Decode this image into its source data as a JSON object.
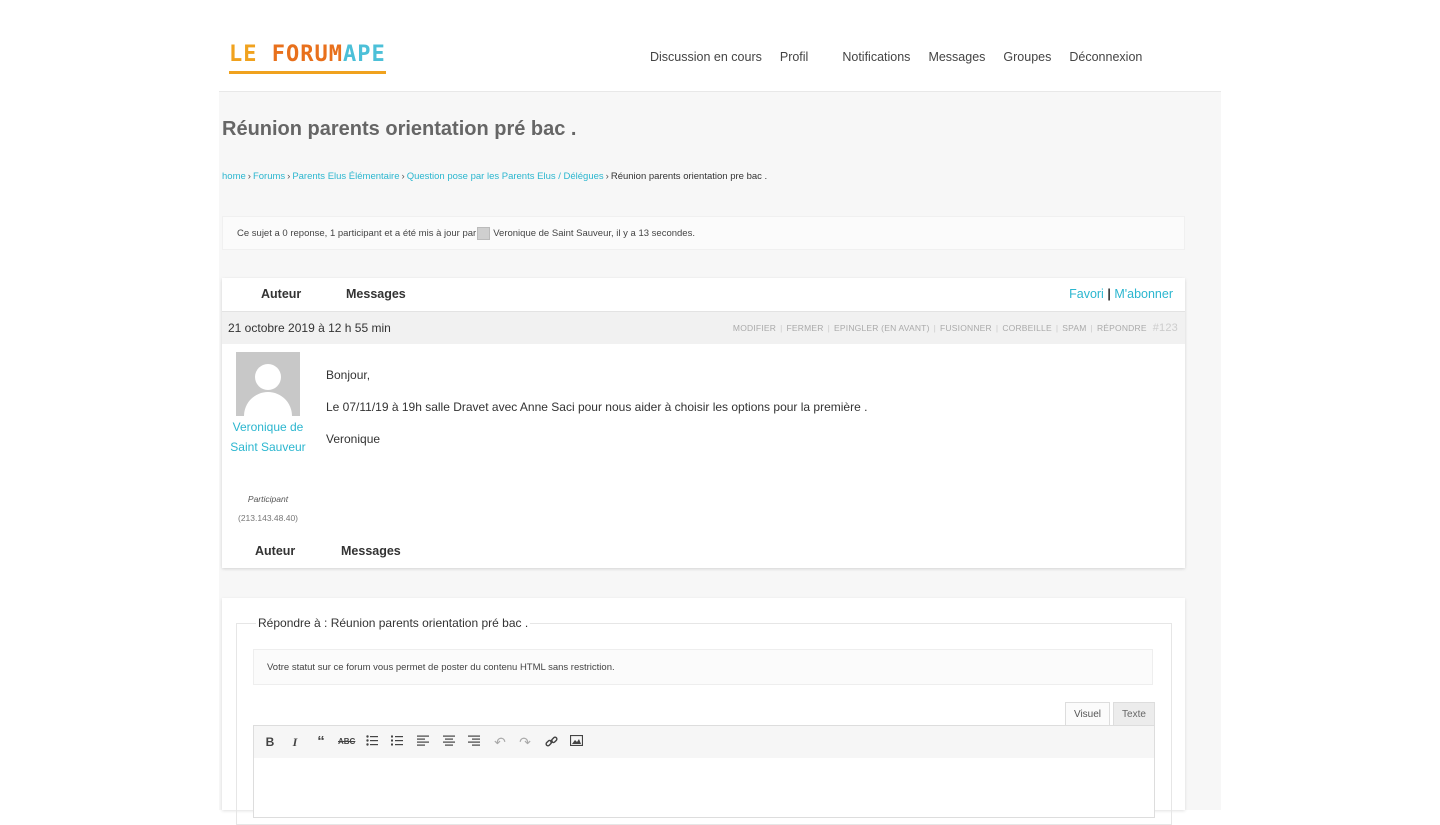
{
  "header": {
    "logo": {
      "part1": "LE ",
      "part2": "FORUM",
      "part3": "APE"
    },
    "nav": [
      "Discussion en cours",
      "Profil",
      "Notifications",
      "Messages",
      "Groupes",
      "Déconnexion"
    ]
  },
  "topic": {
    "title": "Réunion parents orientation pré bac .",
    "breadcrumb": [
      "home",
      "Forums",
      "Parents Elus Élémentaire",
      "Question pose par les Parents Elus / Délégues",
      "Réunion parents orientation pre bac ."
    ],
    "notice": {
      "before": "Ce sujet a 0 reponse, 1 participant et a été mis à jour par",
      "user": "Veronique de Saint Sauveur",
      "after": ", il y a 13 secondes."
    }
  },
  "table": {
    "col_author": "Auteur",
    "col_messages": "Messages",
    "favori": "Favori",
    "separator": "|",
    "subscribe": "M'abonner"
  },
  "post": {
    "date": "21 octobre 2019 à 12 h 55 min",
    "admin_links": [
      "MODIFIER",
      "FERMER",
      "EPINGLER (EN AVANT)",
      "FUSIONNER",
      "CORBEILLE",
      "SPAM",
      "RÉPONDRE"
    ],
    "number": "#123",
    "author": {
      "name": "Veronique de Saint Sauveur",
      "role": "Participant",
      "ip": "(213.143.48.40)"
    },
    "content": [
      "Bonjour,",
      "Le 07/11/19 à 19h salle Dravet avec Anne Saci pour nous aider à choisir les options pour la première .",
      "Veronique"
    ]
  },
  "reply": {
    "legend": "Répondre à : Réunion parents orientation pré bac .",
    "statut": "Votre statut sur ce forum vous permet de poster du contenu HTML sans restriction.",
    "tab_visuel": "Visuel",
    "tab_texte": "Texte",
    "toolbar": [
      "bold-icon",
      "italic-icon",
      "blockquote-icon",
      "strikethrough-icon",
      "bullet-list-icon",
      "numbered-list-icon",
      "align-left-icon",
      "align-center-icon",
      "align-right-icon",
      "undo-icon",
      "redo-icon",
      "link-icon",
      "image-icon"
    ]
  }
}
